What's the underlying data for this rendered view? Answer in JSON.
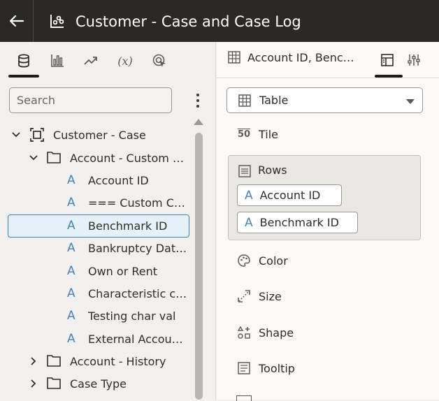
{
  "header": {
    "back_icon": "arrow-left-icon",
    "title_icon": "scatter-chart-icon",
    "title": "Customer - Case and Case Log"
  },
  "left_toolbar": {
    "tabs": [
      {
        "icon": "database-icon",
        "active": true
      },
      {
        "icon": "bar-chart-icon",
        "active": false
      },
      {
        "icon": "trend-line-icon",
        "active": false
      },
      {
        "icon": "function-icon",
        "label": "(x)",
        "active": false
      },
      {
        "icon": "target-cursor-icon",
        "active": false
      }
    ]
  },
  "search": {
    "placeholder": "Search",
    "value": ""
  },
  "tree": {
    "root": {
      "label": "Customer - Case",
      "expanded": true
    },
    "folder_1": {
      "label": "Account - Custom Sub Folder",
      "expanded": true
    },
    "attrs": [
      {
        "label": "Account ID",
        "selected": false
      },
      {
        "label": "=== Custom Column",
        "selected": false
      },
      {
        "label": "Benchmark ID",
        "selected": true
      },
      {
        "label": "Bankruptcy Date Field",
        "selected": false
      },
      {
        "label": "Own or Rent",
        "selected": false
      },
      {
        "label": "Characteristic code",
        "selected": false
      },
      {
        "label": "Testing char val",
        "selected": false
      },
      {
        "label": "External Account ID",
        "selected": false
      }
    ],
    "folder_2": {
      "label": "Account - History",
      "expanded": false
    },
    "folder_3": {
      "label": "Case Type",
      "expanded": false
    },
    "attr_glyph": "A"
  },
  "right_panel": {
    "title": "Account ID, Benchmark ID",
    "tabs": [
      {
        "icon": "grammar-panel-icon",
        "active": true
      },
      {
        "icon": "sliders-icon",
        "active": false
      }
    ],
    "viz_type": {
      "label": "Table"
    },
    "tile_icon_text": "50",
    "tile_label": "Tile",
    "rows": {
      "label": "Rows",
      "items": [
        "Account ID",
        "Benchmark ID"
      ]
    },
    "color_label": "Color",
    "size_label": "Size",
    "shape_label": "Shape",
    "tooltip_label": "Tooltip"
  },
  "colors": {
    "header_bg": "#2b2926",
    "attribute_glyph": "#4a82b3",
    "selection_border": "#3e80b0",
    "selection_bg": "#e6f1f7"
  }
}
